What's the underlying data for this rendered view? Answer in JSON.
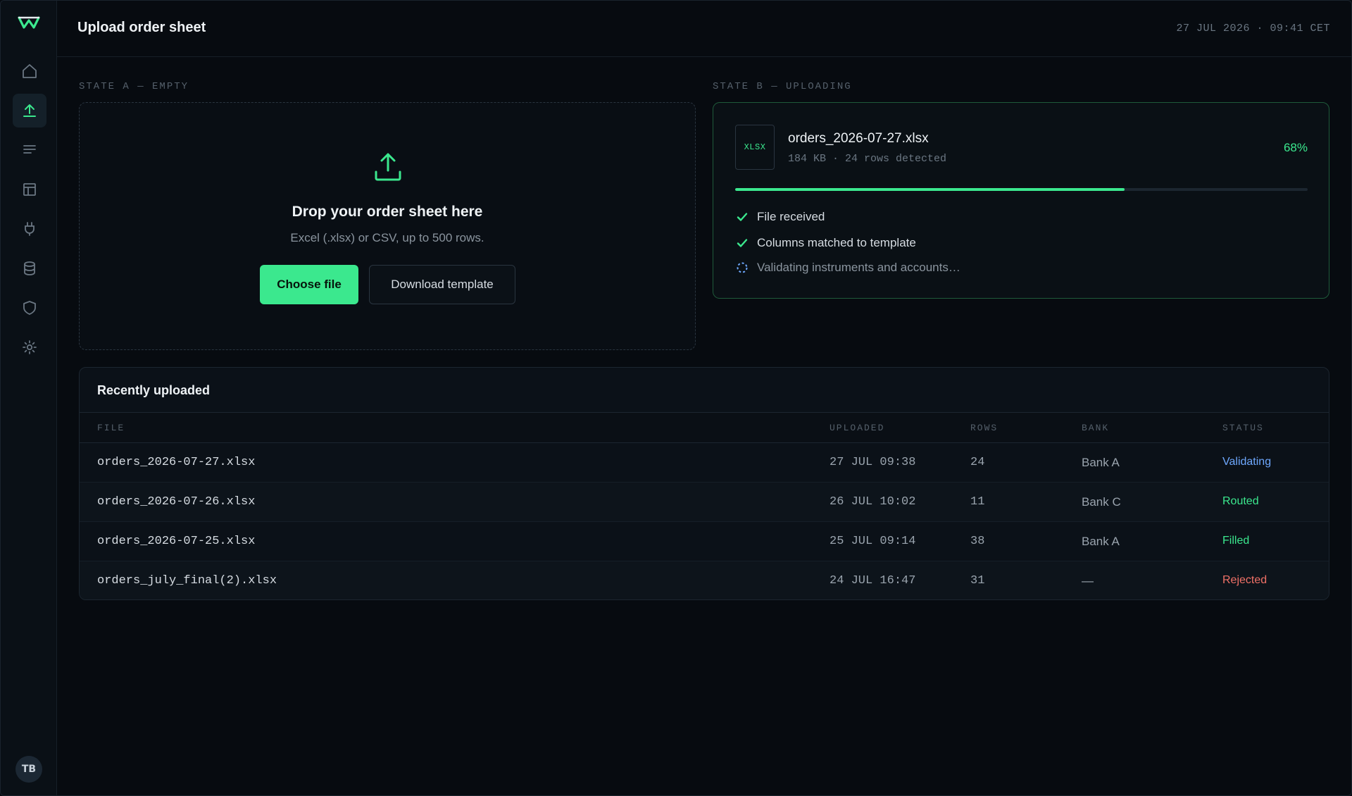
{
  "header": {
    "title": "Upload order sheet",
    "datetime": "27 JUL 2026 · 09:41 CET"
  },
  "sidebar": {
    "logo": "W",
    "items": [
      {
        "icon": "home-icon",
        "active": false
      },
      {
        "icon": "upload-icon",
        "active": true
      },
      {
        "icon": "list-icon",
        "active": false
      },
      {
        "icon": "layout-icon",
        "active": false
      },
      {
        "icon": "plug-icon",
        "active": false
      },
      {
        "icon": "database-icon",
        "active": false
      },
      {
        "icon": "shield-icon",
        "active": false
      },
      {
        "icon": "gear-icon",
        "active": false
      }
    ],
    "avatar": "TB"
  },
  "state_a": {
    "label": "STATE A — EMPTY",
    "title": "Drop your order sheet here",
    "subtitle": "Excel (.xlsx) or CSV, up to 500 rows.",
    "primary_button": "Choose file",
    "secondary_button": "Download template"
  },
  "state_b": {
    "label": "STATE B — UPLOADING",
    "badge": "XLSX",
    "file_name": "orders_2026-07-27.xlsx",
    "file_meta": "184 KB · 24 rows detected",
    "percent_label": "68%",
    "progress": 0.68,
    "steps": [
      {
        "label": "File received",
        "state": "done"
      },
      {
        "label": "Columns matched to template",
        "state": "done"
      },
      {
        "label": "Validating instruments and accounts…",
        "state": "pending"
      }
    ]
  },
  "recent": {
    "title": "Recently uploaded",
    "columns": [
      "FILE",
      "UPLOADED",
      "ROWS",
      "BANK",
      "STATUS"
    ],
    "rows": [
      {
        "file": "orders_2026-07-27.xlsx",
        "uploaded": "27 JUL 09:38",
        "rows": "24",
        "bank": "Bank A",
        "status": "Validating",
        "status_color": "#6ea8fe"
      },
      {
        "file": "orders_2026-07-26.xlsx",
        "uploaded": "26 JUL 10:02",
        "rows": "11",
        "bank": "Bank C",
        "status": "Routed",
        "status_color": "#3be88e"
      },
      {
        "file": "orders_2026-07-25.xlsx",
        "uploaded": "25 JUL 09:14",
        "rows": "38",
        "bank": "Bank A",
        "status": "Filled",
        "status_color": "#3be88e"
      },
      {
        "file": "orders_july_final(2).xlsx",
        "uploaded": "24 JUL 16:47",
        "rows": "31",
        "bank": "—",
        "status": "Rejected",
        "status_color": "#f07167"
      }
    ]
  },
  "colors": {
    "accent": "#3be88e",
    "background": "#070b10",
    "validating": "#6ea8fe",
    "rejected": "#f07167"
  }
}
